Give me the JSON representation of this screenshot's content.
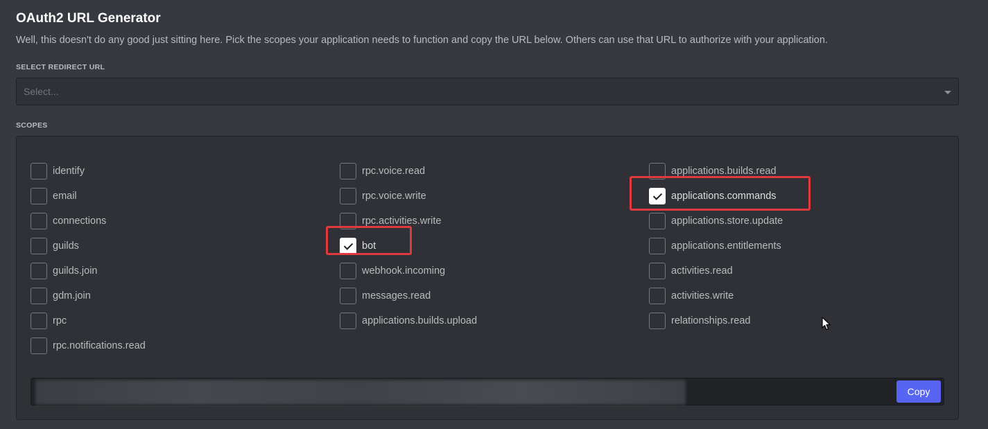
{
  "header": {
    "title": "OAuth2 URL Generator",
    "subtitle": "Well, this doesn't do any good just sitting here. Pick the scopes your application needs to function and copy the URL below. Others can use that URL to authorize with your application."
  },
  "redirect": {
    "label": "SELECT REDIRECT URL",
    "placeholder": "Select..."
  },
  "scopes": {
    "label": "SCOPES",
    "columns": [
      [
        {
          "label": "identify",
          "checked": false
        },
        {
          "label": "email",
          "checked": false
        },
        {
          "label": "connections",
          "checked": false
        },
        {
          "label": "guilds",
          "checked": false
        },
        {
          "label": "guilds.join",
          "checked": false
        },
        {
          "label": "gdm.join",
          "checked": false
        },
        {
          "label": "rpc",
          "checked": false
        },
        {
          "label": "rpc.notifications.read",
          "checked": false
        }
      ],
      [
        {
          "label": "rpc.voice.read",
          "checked": false
        },
        {
          "label": "rpc.voice.write",
          "checked": false
        },
        {
          "label": "rpc.activities.write",
          "checked": false
        },
        {
          "label": "bot",
          "checked": true
        },
        {
          "label": "webhook.incoming",
          "checked": false
        },
        {
          "label": "messages.read",
          "checked": false
        },
        {
          "label": "applications.builds.upload",
          "checked": false
        }
      ],
      [
        {
          "label": "applications.builds.read",
          "checked": false
        },
        {
          "label": "applications.commands",
          "checked": true
        },
        {
          "label": "applications.store.update",
          "checked": false
        },
        {
          "label": "applications.entitlements",
          "checked": false
        },
        {
          "label": "activities.read",
          "checked": false
        },
        {
          "label": "activities.write",
          "checked": false
        },
        {
          "label": "relationships.read",
          "checked": false
        }
      ]
    ]
  },
  "url_output": {
    "copy_label": "Copy"
  },
  "colors": {
    "background": "#36393f",
    "accent": "#5865f2",
    "highlight": "#e03a3e"
  }
}
